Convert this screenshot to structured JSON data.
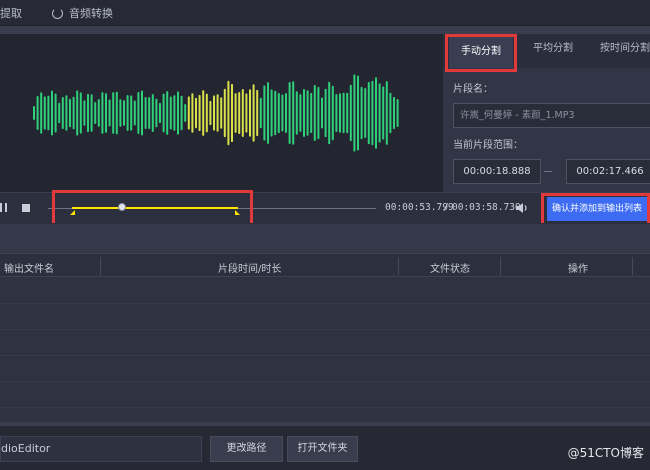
{
  "toolbar": {
    "item1_label": "提取",
    "item2_label": "音频转换"
  },
  "tabs": [
    {
      "label": "手动分割",
      "active": true
    },
    {
      "label": "平均分割",
      "active": false
    },
    {
      "label": "按时间分割",
      "active": false
    }
  ],
  "segment": {
    "name_label": "片段名：",
    "name_placeholder": "许嵩_何曼婷 - 素颜_1.MP3",
    "range_label": "当前片段范围：",
    "start_time": "00:00:18.888",
    "end_time": "00:02:17.466"
  },
  "transport": {
    "current_time": "00:00:53.799",
    "separator": "/",
    "total_time": "00:03:58.730",
    "confirm_label": "确认并添加到输出列表"
  },
  "table": {
    "columns": [
      "输出文件名",
      "片段时间/时长",
      "文件状态",
      "操作"
    ]
  },
  "bottom": {
    "path_value": "dioEditor",
    "change_path_label": "更改路径",
    "open_folder_label": "打开文件夹",
    "watermark": "@51CTO博客"
  },
  "colors": {
    "accent": "#3d6cf2",
    "selection": "#ffe600",
    "highlight": "#e23a3a",
    "wave_green": "#2fd07a",
    "wave_yellow": "#d9e04a"
  },
  "icons": {
    "convert": "refresh-icon",
    "pause": "pause-icon",
    "stop": "stop-icon",
    "volume": "volume-icon"
  }
}
